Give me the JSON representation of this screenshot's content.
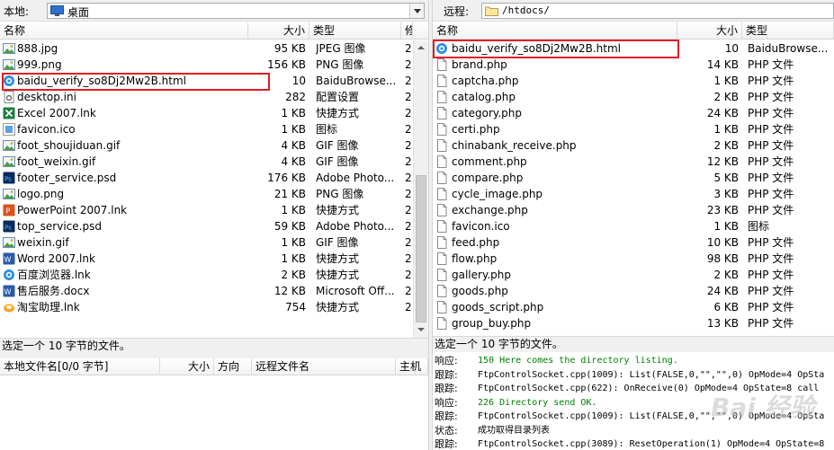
{
  "colors": {
    "highlight": "#e41b23",
    "log_response": "#008000",
    "log_trace": "#000000",
    "folder": "#f3c65b"
  },
  "local": {
    "path_label": "本地:",
    "path_value": "桌面",
    "columns": [
      "名称",
      "大小",
      "类型",
      "修"
    ],
    "files": [
      {
        "name": "888.jpg",
        "size": "95 KB",
        "type": "JPEG 图像",
        "mod": "2",
        "icon": "image-icon"
      },
      {
        "name": "999.png",
        "size": "156 KB",
        "type": "PNG 图像",
        "mod": "2",
        "icon": "image-icon"
      },
      {
        "name": "baidu_verify_so8Dj2Mw2B.html",
        "size": "10",
        "type": "BaiduBrowse...",
        "mod": "2",
        "icon": "browser-icon"
      },
      {
        "name": "desktop.ini",
        "size": "282",
        "type": "配置设置",
        "mod": "2",
        "icon": "settings-file-icon"
      },
      {
        "name": "Excel 2007.lnk",
        "size": "1 KB",
        "type": "快捷方式",
        "mod": "2",
        "icon": "excel-icon"
      },
      {
        "name": "favicon.ico",
        "size": "1 KB",
        "type": "图标",
        "mod": "2",
        "icon": "ico-icon"
      },
      {
        "name": "foot_shoujiduan.gif",
        "size": "4 KB",
        "type": "GIF 图像",
        "mod": "2",
        "icon": "image-icon"
      },
      {
        "name": "foot_weixin.gif",
        "size": "4 KB",
        "type": "GIF 图像",
        "mod": "2",
        "icon": "image-icon"
      },
      {
        "name": "footer_service.psd",
        "size": "176 KB",
        "type": "Adobe Photo...",
        "mod": "2",
        "icon": "psd-icon"
      },
      {
        "name": "logo.png",
        "size": "21 KB",
        "type": "PNG 图像",
        "mod": "2",
        "icon": "image-icon"
      },
      {
        "name": "PowerPoint 2007.lnk",
        "size": "1 KB",
        "type": "快捷方式",
        "mod": "2",
        "icon": "powerpoint-icon"
      },
      {
        "name": "top_service.psd",
        "size": "59 KB",
        "type": "Adobe Photo...",
        "mod": "2",
        "icon": "psd-icon"
      },
      {
        "name": "weixin.gif",
        "size": "1 KB",
        "type": "GIF 图像",
        "mod": "2",
        "icon": "image-icon"
      },
      {
        "name": "Word 2007.lnk",
        "size": "1 KB",
        "type": "快捷方式",
        "mod": "2",
        "icon": "word-icon"
      },
      {
        "name": "百度浏览器.lnk",
        "size": "2 KB",
        "type": "快捷方式",
        "mod": "2",
        "icon": "browser-icon"
      },
      {
        "name": "售后服务.docx",
        "size": "12 KB",
        "type": "Microsoft Off...",
        "mod": "2",
        "icon": "word-icon"
      },
      {
        "name": "淘宝助理.lnk",
        "size": "754",
        "type": "快捷方式",
        "mod": "2",
        "icon": "taobao-icon"
      }
    ],
    "status": "选定一个 10 字节的文件。"
  },
  "remote": {
    "path_label": "远程:",
    "path_value": "/htdocs/",
    "columns": [
      "名称",
      "大小",
      "类型"
    ],
    "files": [
      {
        "name": "baidu_verify_so8Dj2Mw2B.html",
        "size": "10",
        "type": "BaiduBrowse...",
        "icon": "browser-icon"
      },
      {
        "name": "brand.php",
        "size": "14 KB",
        "type": "PHP 文件",
        "icon": "file-icon"
      },
      {
        "name": "captcha.php",
        "size": "1 KB",
        "type": "PHP 文件",
        "icon": "file-icon"
      },
      {
        "name": "catalog.php",
        "size": "2 KB",
        "type": "PHP 文件",
        "icon": "file-icon"
      },
      {
        "name": "category.php",
        "size": "24 KB",
        "type": "PHP 文件",
        "icon": "file-icon"
      },
      {
        "name": "certi.php",
        "size": "1 KB",
        "type": "PHP 文件",
        "icon": "file-icon"
      },
      {
        "name": "chinabank_receive.php",
        "size": "2 KB",
        "type": "PHP 文件",
        "icon": "file-icon"
      },
      {
        "name": "comment.php",
        "size": "12 KB",
        "type": "PHP 文件",
        "icon": "file-icon"
      },
      {
        "name": "compare.php",
        "size": "5 KB",
        "type": "PHP 文件",
        "icon": "file-icon"
      },
      {
        "name": "cycle_image.php",
        "size": "3 KB",
        "type": "PHP 文件",
        "icon": "file-icon"
      },
      {
        "name": "exchange.php",
        "size": "23 KB",
        "type": "PHP 文件",
        "icon": "file-icon"
      },
      {
        "name": "favicon.ico",
        "size": "1 KB",
        "type": "图标",
        "icon": "file-icon"
      },
      {
        "name": "feed.php",
        "size": "10 KB",
        "type": "PHP 文件",
        "icon": "file-icon"
      },
      {
        "name": "flow.php",
        "size": "98 KB",
        "type": "PHP 文件",
        "icon": "file-icon"
      },
      {
        "name": "gallery.php",
        "size": "2 KB",
        "type": "PHP 文件",
        "icon": "file-icon"
      },
      {
        "name": "goods.php",
        "size": "24 KB",
        "type": "PHP 文件",
        "icon": "file-icon"
      },
      {
        "name": "goods_script.php",
        "size": "6 KB",
        "type": "PHP 文件",
        "icon": "file-icon"
      },
      {
        "name": "group_buy.php",
        "size": "13 KB",
        "type": "PHP 文件",
        "icon": "file-icon"
      }
    ],
    "status": "选定一个 10 字节的文件。"
  },
  "queue": {
    "columns": [
      "本地文件名[0/0 字节]",
      "大小",
      "方向",
      "远程文件名",
      "主机"
    ]
  },
  "log": [
    {
      "type": "响应:",
      "msg": "150 Here comes the directory listing.",
      "kind": "response"
    },
    {
      "type": "跟踪:",
      "msg": "FtpControlSocket.cpp(1009): List(FALSE,0,\"\",\"\",0)  OpMode=4 OpSta",
      "kind": "trace"
    },
    {
      "type": "跟踪:",
      "msg": "FtpControlSocket.cpp(622): OnReceive(0)  OpMode=4 OpState=8   call",
      "kind": "trace"
    },
    {
      "type": "响应:",
      "msg": "226 Directory send OK.",
      "kind": "response"
    },
    {
      "type": "跟踪:",
      "msg": "FtpControlSocket.cpp(1009): List(FALSE,0,\"\",\"\",0)  OpMode=4 OpSta",
      "kind": "trace"
    },
    {
      "type": "状态:",
      "msg": "成功取得目录列表",
      "kind": "status"
    },
    {
      "type": "跟踪:",
      "msg": "FtpControlSocket.cpp(3089): ResetOperation(1)  OpMode=4 OpState=8",
      "kind": "trace"
    }
  ],
  "watermark": "Bai 经验"
}
